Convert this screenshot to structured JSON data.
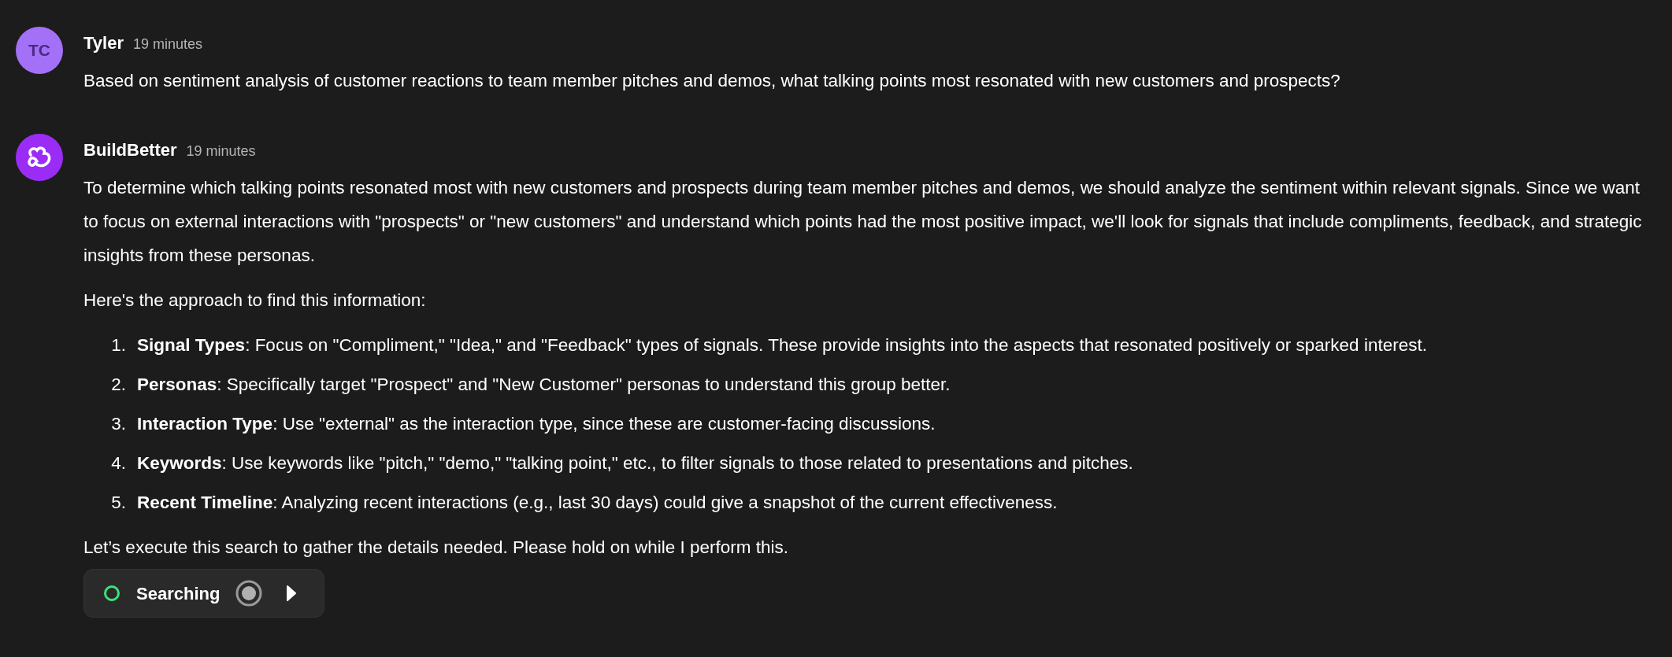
{
  "messages": [
    {
      "kind": "user",
      "author": "Tyler",
      "initials": "TC",
      "time": "19 minutes",
      "paragraphs": [
        "Based on sentiment analysis of customer reactions to team member pitches and demos, what talking points most resonated with new customers and prospects?"
      ]
    },
    {
      "kind": "bot",
      "author": "BuildBetter",
      "time": "19 minutes",
      "paragraphs": [
        "To determine which talking points resonated most with new customers and prospects during team member pitches and demos, we should analyze the sentiment within relevant signals. Since we want to focus on external interactions with \"prospects\" or \"new customers\" and understand which points had the most positive impact, we'll look for signals that include compliments, feedback, and strategic insights from these personas.",
        "Here's the approach to find this information:"
      ],
      "list": [
        {
          "number": "1.",
          "text": "**Signal Types**: Focus on \"Compliment,\" \"Idea,\" and \"Feedback\" types of signals. These provide insights into the aspects that resonated positively or sparked interest."
        },
        {
          "number": "2.",
          "text": "**Personas**: Specifically target \"Prospect\" and \"New Customer\" personas to understand this group better."
        },
        {
          "number": "3.",
          "text": "**Interaction Type**: Use \"external\" as the interaction type, since these are customer-facing discussions."
        },
        {
          "number": "4.",
          "text": "**Keywords**: Use keywords like \"pitch,\" \"demo,\" \"talking point,\" etc., to filter signals to those related to presentations and pitches."
        },
        {
          "number": "5.",
          "text": "**Recent Timeline**: Analyzing recent interactions (e.g., last 30 days) could give a snapshot of the current effectiveness."
        }
      ],
      "closing": "Let’s execute this search to gather the details needed. Please hold on while I perform this.",
      "status": {
        "label": "Searching"
      }
    }
  ]
}
